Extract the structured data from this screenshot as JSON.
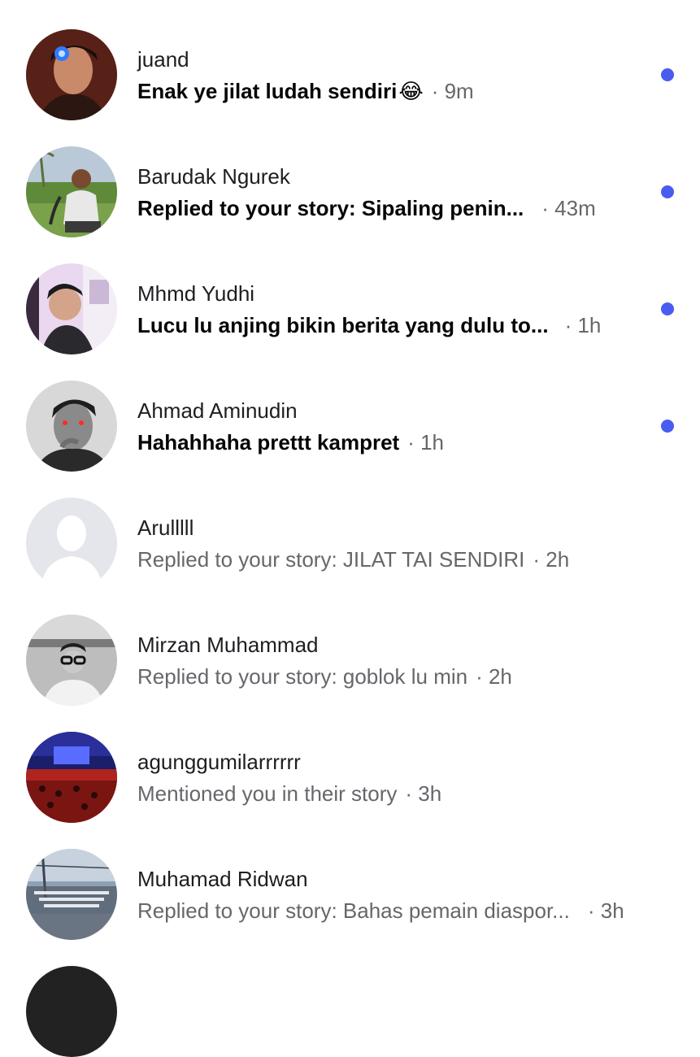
{
  "conversations": [
    {
      "name": "juand",
      "message": "Enak ye jilat ludah sendiri",
      "emoji": "😂",
      "time": "· 9m",
      "unread": true,
      "avatar_icon": "person-photo-red-light"
    },
    {
      "name": "Barudak Ngurek",
      "message": "Replied to your story: Sipaling penin...",
      "emoji": "",
      "time": "· 43m",
      "unread": true,
      "avatar_icon": "person-photo-field"
    },
    {
      "name": "Mhmd Yudhi",
      "message": "Lucu lu anjing bikin berita yang dulu to...",
      "emoji": "",
      "time": "· 1h",
      "unread": true,
      "avatar_icon": "person-photo-pink-room"
    },
    {
      "name": "Ahmad Aminudin",
      "message": "Hahahhaha prettt kampret",
      "emoji": "",
      "time": "· 1h",
      "unread": true,
      "avatar_icon": "person-photo-bw"
    },
    {
      "name": "Arulllll",
      "message": "Replied to your story: JILAT TAI SENDIRI",
      "emoji": "",
      "time": "· 2h",
      "unread": false,
      "avatar_icon": "default-avatar-silhouette"
    },
    {
      "name": "Mirzan Muhammad",
      "message": "Replied to your story: goblok lu min",
      "emoji": "",
      "time": "· 2h",
      "unread": false,
      "avatar_icon": "person-photo-glasses-bw"
    },
    {
      "name": "agunggumilarrrrrr",
      "message": "Mentioned you in their story",
      "emoji": "",
      "time": "· 3h",
      "unread": false,
      "avatar_icon": "crowd-stadium-photo"
    },
    {
      "name": "Muhamad Ridwan",
      "message": "Replied to your story: Bahas pemain diaspor...",
      "emoji": "",
      "time": "· 3h",
      "unread": false,
      "avatar_icon": "street-text-photo"
    }
  ],
  "colors": {
    "unread_dot": "#4a5cf0",
    "primary_text": "#050505",
    "secondary_text": "#65676b"
  }
}
